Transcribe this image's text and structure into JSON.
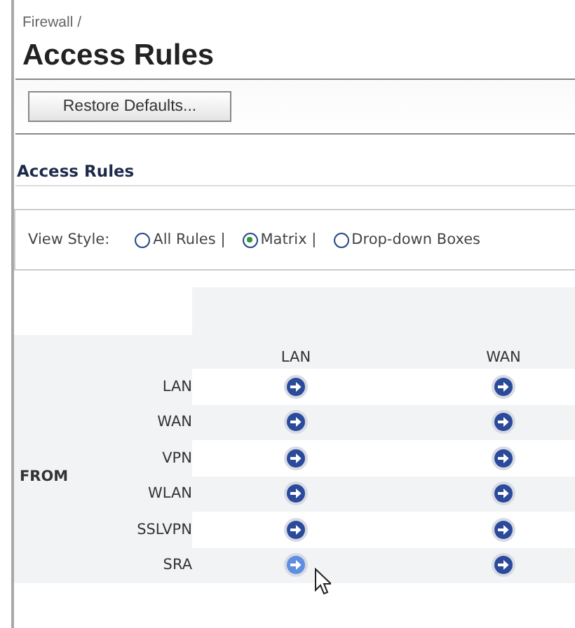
{
  "breadcrumb": "Firewall /",
  "title": "Access Rules",
  "toolbar": {
    "buttons": [
      "Restore Defaults..."
    ]
  },
  "section": {
    "title": "Access Rules"
  },
  "view_style": {
    "label": "View Style:",
    "options": [
      {
        "label": "All Rules |",
        "selected": false
      },
      {
        "label": "Matrix |",
        "selected": true
      },
      {
        "label": "Drop-down Boxes",
        "selected": false
      }
    ]
  },
  "matrix": {
    "row_group_label": "FROM",
    "columns": [
      "LAN",
      "WAN"
    ],
    "rows": [
      {
        "label": "LAN",
        "cells": [
          {
            "highlighted": false
          },
          {
            "highlighted": false
          }
        ]
      },
      {
        "label": "WAN",
        "cells": [
          {
            "highlighted": false
          },
          {
            "highlighted": false
          }
        ]
      },
      {
        "label": "VPN",
        "cells": [
          {
            "highlighted": false
          },
          {
            "highlighted": false
          }
        ]
      },
      {
        "label": "WLAN",
        "cells": [
          {
            "highlighted": false
          },
          {
            "highlighted": false
          }
        ]
      },
      {
        "label": "SSLVPN",
        "cells": [
          {
            "highlighted": false
          },
          {
            "highlighted": false
          }
        ]
      },
      {
        "label": "SRA",
        "cells": [
          {
            "highlighted": true
          },
          {
            "highlighted": false
          }
        ]
      }
    ]
  }
}
